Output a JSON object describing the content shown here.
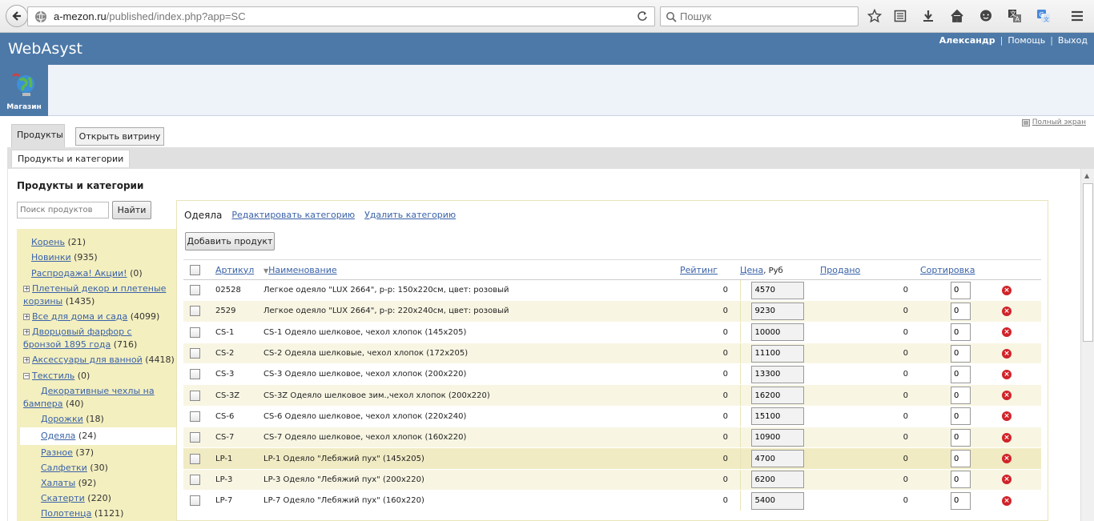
{
  "browser": {
    "url_host": "a-mezon.ru",
    "url_path": "/published/index.php?app=SC",
    "search_placeholder": "Пошук"
  },
  "header": {
    "logo": "WebAsyst",
    "user": "Александр",
    "help": "Помощь",
    "logout": "Выход",
    "sep": "|"
  },
  "app": {
    "label": "Магазин"
  },
  "fullscreen": "Полный экран",
  "tabs": {
    "products": "Продукты",
    "open_store": "Открыть витрину",
    "sub": "Продукты и категории"
  },
  "sidebar": {
    "title": "Продукты и категории",
    "search_placeholder": "Поиск продуктов",
    "search_button": "Найти",
    "items": [
      {
        "label": "Корень",
        "count": " (21)"
      },
      {
        "label": "Новинки",
        "count": " (935)"
      },
      {
        "label": "Распродажа! Акции!",
        "count": " (0)"
      },
      {
        "label": "Плетеный декор и плетеные корзины",
        "count": " (1435)"
      },
      {
        "label": "Все для дома и сада",
        "count": " (4099)"
      },
      {
        "label": "Дворцовый фарфор с бронзой 1895 года",
        "count": " (716)"
      },
      {
        "label": "Аксессуары для ванной",
        "count": " (4418)"
      },
      {
        "label": "Текстиль",
        "count": " (0)"
      },
      {
        "label": "Декоративные чехлы на бампера",
        "count": " (40)"
      },
      {
        "label": "Дорожки",
        "count": " (18)"
      },
      {
        "label": "Одеяла",
        "count": " (24)"
      },
      {
        "label": "Разное",
        "count": " (37)"
      },
      {
        "label": "Салфетки",
        "count": " (30)"
      },
      {
        "label": "Халаты",
        "count": " (92)"
      },
      {
        "label": "Скатерти",
        "count": " (220)"
      },
      {
        "label": "Полотенца",
        "count": " (1121)"
      }
    ]
  },
  "category": {
    "name": "Одеяла",
    "edit": "Редактировать категорию",
    "delete": "Удалить категорию",
    "add_product": "Добавить продукт"
  },
  "table": {
    "headers": {
      "sku": "Артикул",
      "name": "Наименование",
      "rating": "Рейтинг",
      "price": "Цена",
      "currency": ", Руб",
      "sold": "Продано",
      "sort": "Сортировка"
    },
    "rows": [
      {
        "sku": "02528",
        "name": "Легкое одеяло \"LUX 2664\", р-р: 150x220см, цвет: розовый",
        "rating": "0",
        "price": "4570",
        "sold": "0",
        "sort": "0"
      },
      {
        "sku": "2529",
        "name": "Легкое одеяло \"LUX 2664\", р-р: 220x240см, цвет: розовый",
        "rating": "0",
        "price": "9230",
        "sold": "0",
        "sort": "0"
      },
      {
        "sku": "CS-1",
        "name": "CS-1 Одеяло шелковое, чехол хлопок (145x205)",
        "rating": "0",
        "price": "10000",
        "sold": "0",
        "sort": "0"
      },
      {
        "sku": "CS-2",
        "name": "CS-2 Одеяла шелковые, чехол хлопок (172x205)",
        "rating": "0",
        "price": "11100",
        "sold": "0",
        "sort": "0"
      },
      {
        "sku": "CS-3",
        "name": "CS-3 Одеяло шелковое, чехол хлопок (200x220)",
        "rating": "0",
        "price": "13300",
        "sold": "0",
        "sort": "0"
      },
      {
        "sku": "CS-3Z",
        "name": "CS-3Z Одеяло шелковое зим.,чехол хлопок (200x220)",
        "rating": "0",
        "price": "16200",
        "sold": "0",
        "sort": "0"
      },
      {
        "sku": "CS-6",
        "name": "CS-6 Одеяло шелковое, чехол хлопок (220x240)",
        "rating": "0",
        "price": "15100",
        "sold": "0",
        "sort": "0"
      },
      {
        "sku": "CS-7",
        "name": "CS-7 Одеяло шелковое, чехол хлопок (160x220)",
        "rating": "0",
        "price": "10900",
        "sold": "0",
        "sort": "0"
      },
      {
        "sku": "LP-1",
        "name": "LP-1 Одеяло \"Лебяжий пух\" (145x205)",
        "rating": "0",
        "price": "4700",
        "sold": "0",
        "sort": "0"
      },
      {
        "sku": "LP-3",
        "name": "LP-3 Одеяло \"Лебяжий пух\" (200x220)",
        "rating": "0",
        "price": "6200",
        "sold": "0",
        "sort": "0"
      },
      {
        "sku": "LP-7",
        "name": "LP-7 Одеяло \"Лебяжий пух\" (160x220)",
        "rating": "0",
        "price": "5400",
        "sold": "0",
        "sort": "0"
      }
    ]
  },
  "colors": {
    "header_blue": "#4d79a8",
    "tree_bg": "#f3efbf",
    "link": "#3a62a8",
    "delete_red": "#d0242a"
  }
}
